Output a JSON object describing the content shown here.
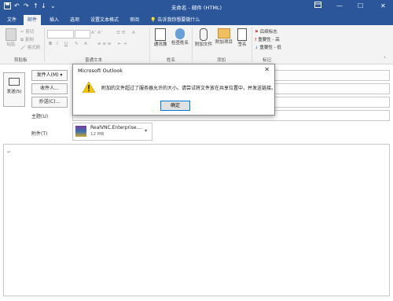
{
  "window": {
    "title": "未命名 - 邮件 (HTML)",
    "controls": [
      "—",
      "☐",
      "✕"
    ]
  },
  "quick_access": {
    "save_icon": "save-icon",
    "undo": "↶",
    "redo": "↷",
    "up": "↑",
    "down": "↓",
    "more": "⌄"
  },
  "tabs": [
    "文件",
    "邮件",
    "插入",
    "选项",
    "设置文本格式",
    "审阅"
  ],
  "tell_me": "告诉我你想要做什么",
  "ribbon": {
    "clipboard": {
      "paste": "粘贴",
      "cut": "剪切",
      "copy": "复制",
      "format_painter": "格式刷",
      "label": "剪贴板"
    },
    "basic_text": {
      "label": "普通文本"
    },
    "names": {
      "address_book": "通讯簿",
      "check_names": "检查姓名",
      "label": "姓名"
    },
    "include": {
      "attach_file": "附加文件",
      "attach_item": "附加项目",
      "signature": "签名",
      "label": "添加"
    },
    "tags": {
      "follow_up": "后续标志",
      "high_importance": "重要性 - 高",
      "low_importance": "重要性 - 低",
      "label": "标记"
    }
  },
  "compose": {
    "send": "发送(S)",
    "from": "发件人(M) ▾",
    "to": "收件人...",
    "cc": "抄送(C)...",
    "subject": "主题(U)",
    "attached": "附件(T)",
    "attachment": {
      "name": "RealVNC.Enterprise....",
      "size": "12 MB"
    },
    "body_mark": "↵"
  },
  "dialog": {
    "title": "Microsoft Outlook",
    "close": "✕",
    "message": "附加的文件超过了服务器允许的大小。请尝试将文件放在共享位置中，并发送链接。",
    "ok": "确定"
  }
}
